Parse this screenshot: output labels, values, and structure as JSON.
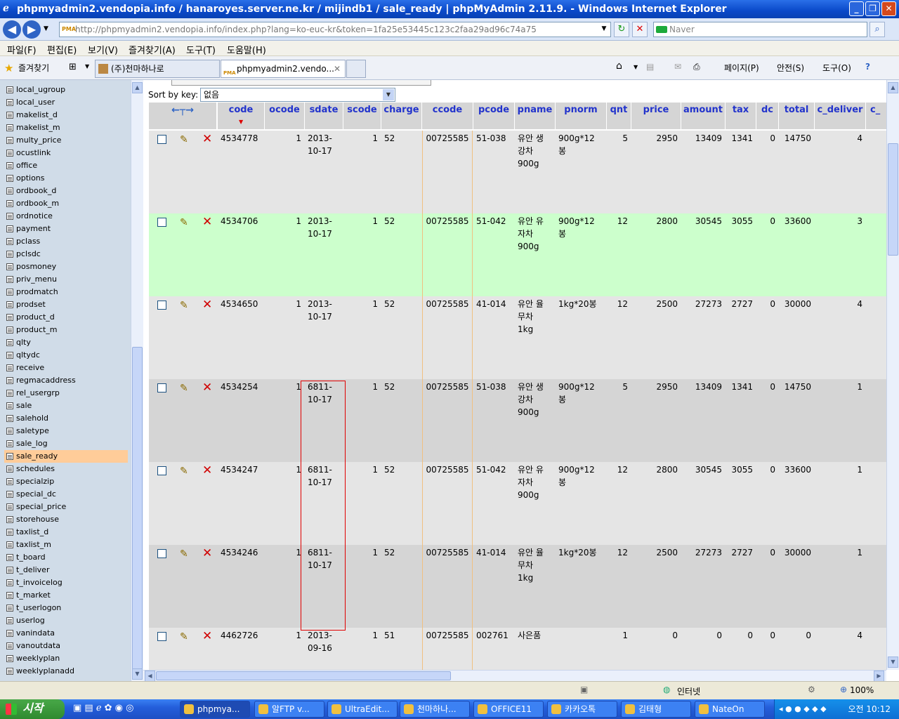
{
  "window": {
    "title": "phpmyadmin2.vendopia.info / hanaroyes.server.ne.kr / mijindb1 / sale_ready | phpMyAdmin 2.11.9. - Windows Internet Explorer"
  },
  "address": {
    "url": "http://phpmyadmin2.vendopia.info/index.php?lang=ko-euc-kr&token=1fa25e53445c123c2faa29ad96c74a75",
    "search_placeholder": "Naver"
  },
  "menu": [
    "파일(F)",
    "편집(E)",
    "보기(V)",
    "즐겨찾기(A)",
    "도구(T)",
    "도움말(H)"
  ],
  "favbar": {
    "favorites_label": "즐겨찾기",
    "tabs": [
      "(주)천마하나로",
      "phpmyadmin2.vendo..."
    ],
    "tools": [
      "페이지(P)",
      "안전(S)",
      "도구(O)"
    ]
  },
  "sidebar": {
    "tables": [
      "local_ugroup",
      "local_user",
      "makelist_d",
      "makelist_m",
      "multy_price",
      "ocustlink",
      "office",
      "options",
      "ordbook_d",
      "ordbook_m",
      "ordnotice",
      "payment",
      "pclass",
      "pclsdc",
      "posmoney",
      "priv_menu",
      "prodmatch",
      "prodset",
      "product_d",
      "product_m",
      "qlty",
      "qltydc",
      "receive",
      "regmacaddress",
      "rel_usergrp",
      "sale",
      "salehold",
      "saletype",
      "sale_log",
      "sale_ready",
      "schedules",
      "specialzip",
      "special_dc",
      "special_price",
      "storehouse",
      "taxlist_d",
      "taxlist_m",
      "t_board",
      "t_deliver",
      "t_invoicelog",
      "t_market",
      "t_userlogon",
      "userlog",
      "vanindata",
      "vanoutdata",
      "weeklyplan",
      "weeklyplanadd"
    ],
    "selected": "sale_ready"
  },
  "sort": {
    "label": "Sort by key:",
    "value": "없음"
  },
  "columns": [
    "code",
    "ocode",
    "sdate",
    "scode",
    "charge",
    "ccode",
    "pcode",
    "pname",
    "pnorm",
    "qnt",
    "price",
    "amount",
    "tax",
    "dc",
    "total",
    "c_deliver",
    "c_"
  ],
  "rows": [
    {
      "code": "4534778",
      "ocode": "1",
      "sdate": [
        "2013-",
        "10-17"
      ],
      "scode": "1",
      "charge": "52",
      "ccode": "00725585",
      "pcode": "51-038",
      "pname": [
        "유안 생",
        "강차",
        "900g"
      ],
      "pnorm": [
        "900g*12",
        "봉"
      ],
      "qnt": "5",
      "price": "2950",
      "amount": "13409",
      "tax": "1341",
      "dc": "0",
      "total": "14750",
      "c_deliver": "4"
    },
    {
      "code": "4534706",
      "ocode": "1",
      "sdate": [
        "2013-",
        "10-17"
      ],
      "scode": "1",
      "charge": "52",
      "ccode": "00725585",
      "pcode": "51-042",
      "pname": [
        "유안 유",
        "자차",
        "900g"
      ],
      "pnorm": [
        "900g*12",
        "봉"
      ],
      "qnt": "12",
      "price": "2800",
      "amount": "30545",
      "tax": "3055",
      "dc": "0",
      "total": "33600",
      "c_deliver": "3"
    },
    {
      "code": "4534650",
      "ocode": "1",
      "sdate": [
        "2013-",
        "10-17"
      ],
      "scode": "1",
      "charge": "52",
      "ccode": "00725585",
      "pcode": "41-014",
      "pname": [
        "유안 율",
        "무차",
        "1kg"
      ],
      "pnorm": [
        "1kg*20봉"
      ],
      "qnt": "12",
      "price": "2500",
      "amount": "27273",
      "tax": "2727",
      "dc": "0",
      "total": "30000",
      "c_deliver": "4"
    },
    {
      "code": "4534254",
      "ocode": "1",
      "sdate": [
        "6811-",
        "10-17"
      ],
      "scode": "1",
      "charge": "52",
      "ccode": "00725585",
      "pcode": "51-038",
      "pname": [
        "유안 생",
        "강차",
        "900g"
      ],
      "pnorm": [
        "900g*12",
        "봉"
      ],
      "qnt": "5",
      "price": "2950",
      "amount": "13409",
      "tax": "1341",
      "dc": "0",
      "total": "14750",
      "c_deliver": "1"
    },
    {
      "code": "4534247",
      "ocode": "1",
      "sdate": [
        "6811-",
        "10-17"
      ],
      "scode": "1",
      "charge": "52",
      "ccode": "00725585",
      "pcode": "51-042",
      "pname": [
        "유안 유",
        "자차",
        "900g"
      ],
      "pnorm": [
        "900g*12",
        "봉"
      ],
      "qnt": "12",
      "price": "2800",
      "amount": "30545",
      "tax": "3055",
      "dc": "0",
      "total": "33600",
      "c_deliver": "1"
    },
    {
      "code": "4534246",
      "ocode": "1",
      "sdate": [
        "6811-",
        "10-17"
      ],
      "scode": "1",
      "charge": "52",
      "ccode": "00725585",
      "pcode": "41-014",
      "pname": [
        "유안 율",
        "무차",
        "1kg"
      ],
      "pnorm": [
        "1kg*20봉"
      ],
      "qnt": "12",
      "price": "2500",
      "amount": "27273",
      "tax": "2727",
      "dc": "0",
      "total": "30000",
      "c_deliver": "1"
    },
    {
      "code": "4462726",
      "ocode": "1",
      "sdate": [
        "2013-",
        "09-16"
      ],
      "scode": "1",
      "charge": "51",
      "ccode": "00725585",
      "pcode": "002761",
      "pname": [
        "사은품"
      ],
      "pnorm": [],
      "qnt": "1",
      "price": "0",
      "amount": "0",
      "tax": "0",
      "dc": "0",
      "total": "0",
      "c_deliver": "4"
    }
  ],
  "status": {
    "zone": "인터넷",
    "zoom": "100%"
  },
  "taskbar": {
    "start": "시작",
    "tasks": [
      "phpmya...",
      "알FTP v...",
      "UltraEdit...",
      "천마하나...",
      "OFFICE11",
      "카카오톡",
      "김태형",
      "NateOn"
    ],
    "clock": "오전 10:12"
  },
  "colors": {
    "title_blue": "#0a49c9",
    "header_text": "#2233cc",
    "row_highlight": "#ccffcc",
    "selected_table": "#ffcc99",
    "delete_red": "#d00000"
  }
}
